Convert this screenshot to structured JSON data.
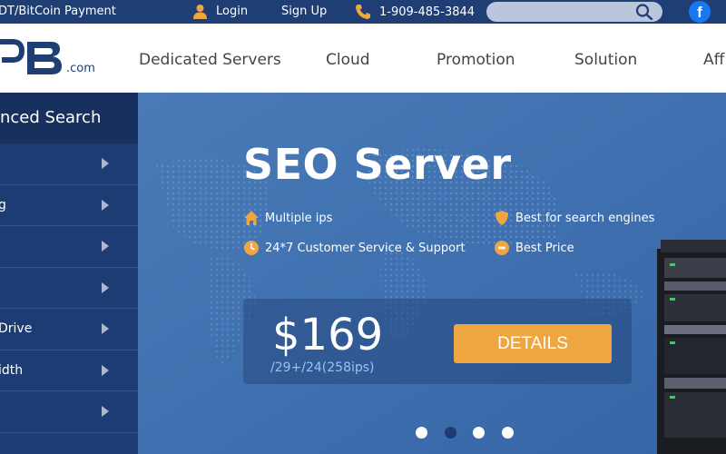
{
  "topbar": {
    "payment_text": "DT/BitCoin Payment",
    "login_label": "Login",
    "signup_label": "Sign Up",
    "phone": "1-909-485-3844",
    "search_placeholder": "",
    "facebook_glyph": "f"
  },
  "header": {
    "logo_suffix": ".com",
    "nav": [
      "Dedicated Servers",
      "Cloud",
      "Promotion",
      "Solution",
      "Aff"
    ]
  },
  "sidebar": {
    "title": "nced Search",
    "items": [
      "",
      "g",
      "",
      "",
      "Drive",
      "idth",
      "",
      ""
    ]
  },
  "hero": {
    "title": "SEO Server",
    "features": [
      {
        "text": "Multiple ips",
        "icon": "home-icon"
      },
      {
        "text": "Best for search engines",
        "icon": "shield-icon"
      },
      {
        "text": "24*7 Customer Service & Support",
        "icon": "clock-icon"
      },
      {
        "text": "Best Price",
        "icon": "price-tag-icon"
      }
    ],
    "price": "$169",
    "price_note": "/29+/24(258ips)",
    "details_label": "DETAILS",
    "active_slide": 2,
    "slide_count": 4
  },
  "colors": {
    "topbar": "#1f3e74",
    "sidebar": "#1d3c73",
    "hero": "#3d6fae",
    "accent": "#f0a640",
    "icon_orange": "#f0a640"
  }
}
